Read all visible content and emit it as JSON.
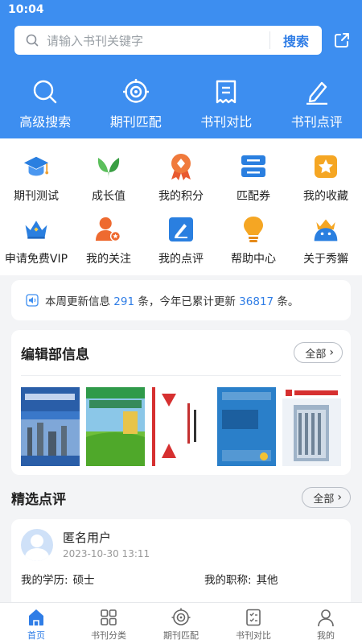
{
  "status": {
    "time": "10:04"
  },
  "search": {
    "placeholder": "请输入书刊关键字",
    "button": "搜索"
  },
  "top_nav": [
    {
      "label": "高级搜索",
      "icon": "search-icon"
    },
    {
      "label": "期刊匹配",
      "icon": "target-icon"
    },
    {
      "label": "书刊对比",
      "icon": "document-icon"
    },
    {
      "label": "书刊点评",
      "icon": "pencil-icon"
    }
  ],
  "grid": [
    {
      "label": "期刊测试",
      "icon": "graduation-cap-icon"
    },
    {
      "label": "成长值",
      "icon": "sprout-icon"
    },
    {
      "label": "我的积分",
      "icon": "medal-icon"
    },
    {
      "label": "匹配券",
      "icon": "coupon-icon"
    },
    {
      "label": "我的收藏",
      "icon": "star-box-icon"
    },
    {
      "label": "申请免费VIP",
      "icon": "crown-icon"
    },
    {
      "label": "我的关注",
      "icon": "user-star-icon"
    },
    {
      "label": "我的点评",
      "icon": "edit-icon"
    },
    {
      "label": "帮助中心",
      "icon": "bulb-icon"
    },
    {
      "label": "关于秀獬",
      "icon": "mascot-icon"
    }
  ],
  "notice": {
    "prefix": "本周更新信息",
    "week_count": "291",
    "middle": "条，今年已累计更新",
    "year_count": "36817",
    "suffix": "条。"
  },
  "editorial": {
    "title": "编辑部信息",
    "more": "全部"
  },
  "reviews": {
    "title": "精选点评",
    "more": "全部",
    "item": {
      "user": "匿名用户",
      "date": "2023-10-30 13:11",
      "edu_label": "我的学历:",
      "edu_value": "硕士",
      "title_label": "我的职称:",
      "title_value": "其他"
    }
  },
  "tabbar": [
    {
      "label": "首页",
      "icon": "home-icon",
      "active": true
    },
    {
      "label": "书刊分类",
      "icon": "category-icon"
    },
    {
      "label": "期刊匹配",
      "icon": "target-icon"
    },
    {
      "label": "书刊对比",
      "icon": "compare-icon"
    },
    {
      "label": "我的",
      "icon": "user-icon"
    }
  ]
}
